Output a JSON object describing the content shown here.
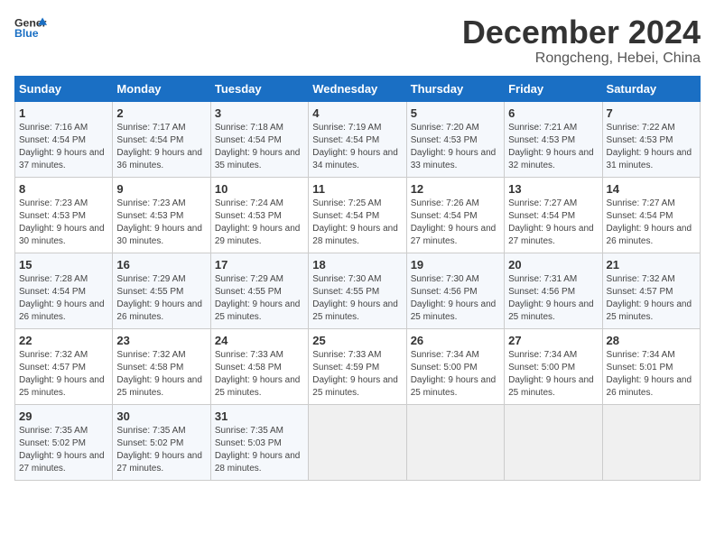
{
  "logo": {
    "line1": "General",
    "line2": "Blue"
  },
  "title": "December 2024",
  "subtitle": "Rongcheng, Hebei, China",
  "days_of_week": [
    "Sunday",
    "Monday",
    "Tuesday",
    "Wednesday",
    "Thursday",
    "Friday",
    "Saturday"
  ],
  "weeks": [
    [
      {
        "day": 1,
        "sunrise": "Sunrise: 7:16 AM",
        "sunset": "Sunset: 4:54 PM",
        "daylight": "Daylight: 9 hours and 37 minutes."
      },
      {
        "day": 2,
        "sunrise": "Sunrise: 7:17 AM",
        "sunset": "Sunset: 4:54 PM",
        "daylight": "Daylight: 9 hours and 36 minutes."
      },
      {
        "day": 3,
        "sunrise": "Sunrise: 7:18 AM",
        "sunset": "Sunset: 4:54 PM",
        "daylight": "Daylight: 9 hours and 35 minutes."
      },
      {
        "day": 4,
        "sunrise": "Sunrise: 7:19 AM",
        "sunset": "Sunset: 4:54 PM",
        "daylight": "Daylight: 9 hours and 34 minutes."
      },
      {
        "day": 5,
        "sunrise": "Sunrise: 7:20 AM",
        "sunset": "Sunset: 4:53 PM",
        "daylight": "Daylight: 9 hours and 33 minutes."
      },
      {
        "day": 6,
        "sunrise": "Sunrise: 7:21 AM",
        "sunset": "Sunset: 4:53 PM",
        "daylight": "Daylight: 9 hours and 32 minutes."
      },
      {
        "day": 7,
        "sunrise": "Sunrise: 7:22 AM",
        "sunset": "Sunset: 4:53 PM",
        "daylight": "Daylight: 9 hours and 31 minutes."
      }
    ],
    [
      {
        "day": 8,
        "sunrise": "Sunrise: 7:23 AM",
        "sunset": "Sunset: 4:53 PM",
        "daylight": "Daylight: 9 hours and 30 minutes."
      },
      {
        "day": 9,
        "sunrise": "Sunrise: 7:23 AM",
        "sunset": "Sunset: 4:53 PM",
        "daylight": "Daylight: 9 hours and 30 minutes."
      },
      {
        "day": 10,
        "sunrise": "Sunrise: 7:24 AM",
        "sunset": "Sunset: 4:53 PM",
        "daylight": "Daylight: 9 hours and 29 minutes."
      },
      {
        "day": 11,
        "sunrise": "Sunrise: 7:25 AM",
        "sunset": "Sunset: 4:54 PM",
        "daylight": "Daylight: 9 hours and 28 minutes."
      },
      {
        "day": 12,
        "sunrise": "Sunrise: 7:26 AM",
        "sunset": "Sunset: 4:54 PM",
        "daylight": "Daylight: 9 hours and 27 minutes."
      },
      {
        "day": 13,
        "sunrise": "Sunrise: 7:27 AM",
        "sunset": "Sunset: 4:54 PM",
        "daylight": "Daylight: 9 hours and 27 minutes."
      },
      {
        "day": 14,
        "sunrise": "Sunrise: 7:27 AM",
        "sunset": "Sunset: 4:54 PM",
        "daylight": "Daylight: 9 hours and 26 minutes."
      }
    ],
    [
      {
        "day": 15,
        "sunrise": "Sunrise: 7:28 AM",
        "sunset": "Sunset: 4:54 PM",
        "daylight": "Daylight: 9 hours and 26 minutes."
      },
      {
        "day": 16,
        "sunrise": "Sunrise: 7:29 AM",
        "sunset": "Sunset: 4:55 PM",
        "daylight": "Daylight: 9 hours and 26 minutes."
      },
      {
        "day": 17,
        "sunrise": "Sunrise: 7:29 AM",
        "sunset": "Sunset: 4:55 PM",
        "daylight": "Daylight: 9 hours and 25 minutes."
      },
      {
        "day": 18,
        "sunrise": "Sunrise: 7:30 AM",
        "sunset": "Sunset: 4:55 PM",
        "daylight": "Daylight: 9 hours and 25 minutes."
      },
      {
        "day": 19,
        "sunrise": "Sunrise: 7:30 AM",
        "sunset": "Sunset: 4:56 PM",
        "daylight": "Daylight: 9 hours and 25 minutes."
      },
      {
        "day": 20,
        "sunrise": "Sunrise: 7:31 AM",
        "sunset": "Sunset: 4:56 PM",
        "daylight": "Daylight: 9 hours and 25 minutes."
      },
      {
        "day": 21,
        "sunrise": "Sunrise: 7:32 AM",
        "sunset": "Sunset: 4:57 PM",
        "daylight": "Daylight: 9 hours and 25 minutes."
      }
    ],
    [
      {
        "day": 22,
        "sunrise": "Sunrise: 7:32 AM",
        "sunset": "Sunset: 4:57 PM",
        "daylight": "Daylight: 9 hours and 25 minutes."
      },
      {
        "day": 23,
        "sunrise": "Sunrise: 7:32 AM",
        "sunset": "Sunset: 4:58 PM",
        "daylight": "Daylight: 9 hours and 25 minutes."
      },
      {
        "day": 24,
        "sunrise": "Sunrise: 7:33 AM",
        "sunset": "Sunset: 4:58 PM",
        "daylight": "Daylight: 9 hours and 25 minutes."
      },
      {
        "day": 25,
        "sunrise": "Sunrise: 7:33 AM",
        "sunset": "Sunset: 4:59 PM",
        "daylight": "Daylight: 9 hours and 25 minutes."
      },
      {
        "day": 26,
        "sunrise": "Sunrise: 7:34 AM",
        "sunset": "Sunset: 5:00 PM",
        "daylight": "Daylight: 9 hours and 25 minutes."
      },
      {
        "day": 27,
        "sunrise": "Sunrise: 7:34 AM",
        "sunset": "Sunset: 5:00 PM",
        "daylight": "Daylight: 9 hours and 25 minutes."
      },
      {
        "day": 28,
        "sunrise": "Sunrise: 7:34 AM",
        "sunset": "Sunset: 5:01 PM",
        "daylight": "Daylight: 9 hours and 26 minutes."
      }
    ],
    [
      {
        "day": 29,
        "sunrise": "Sunrise: 7:35 AM",
        "sunset": "Sunset: 5:02 PM",
        "daylight": "Daylight: 9 hours and 27 minutes."
      },
      {
        "day": 30,
        "sunrise": "Sunrise: 7:35 AM",
        "sunset": "Sunset: 5:02 PM",
        "daylight": "Daylight: 9 hours and 27 minutes."
      },
      {
        "day": 31,
        "sunrise": "Sunrise: 7:35 AM",
        "sunset": "Sunset: 5:03 PM",
        "daylight": "Daylight: 9 hours and 28 minutes."
      },
      null,
      null,
      null,
      null
    ]
  ]
}
